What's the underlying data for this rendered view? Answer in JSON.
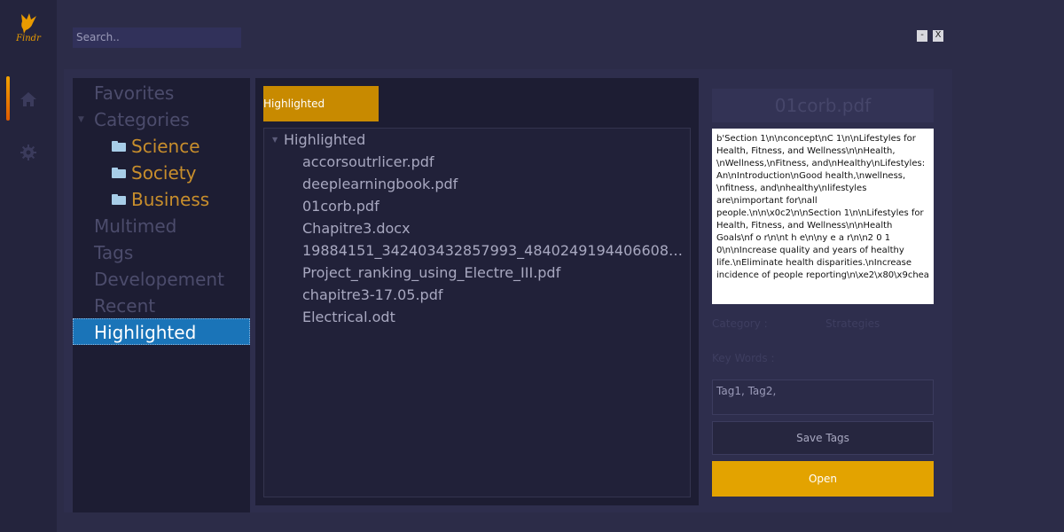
{
  "app": {
    "logo_text": "Findr"
  },
  "search": {
    "placeholder": "Search.."
  },
  "window": {
    "minimize": "-",
    "close": "X"
  },
  "sidebar": {
    "items": [
      {
        "label": "Favorites"
      },
      {
        "label": "Categories"
      },
      {
        "label": "Science"
      },
      {
        "label": "Society"
      },
      {
        "label": "Business"
      },
      {
        "label": "Multimed"
      },
      {
        "label": "Tags"
      },
      {
        "label": "Developement"
      },
      {
        "label": "Recent"
      },
      {
        "label": "Highlighted"
      }
    ],
    "active": "Highlighted"
  },
  "middle": {
    "tab_label": "Highlighted",
    "tree_root": "Highlighted",
    "files": [
      "accorsoutrlicer.pdf",
      "deeplearningbook.pdf",
      "01corb.pdf",
      "Chapitre3.docx",
      "19884151_342403432857993_4840249194406608117_n....",
      "Project_ranking_using_Electre_III.pdf",
      "chapitre3-17.05.pdf",
      "Electrical.odt"
    ]
  },
  "details": {
    "file_title": "01corb.pdf",
    "content": "b'Section 1\\n\\nconcept\\nC 1\\n\\nLifestyles for Health, Fitness, and Wellness\\n\\nHealth, \\nWellness,\\nFitness, and\\nHealthy\\nLifestyles: An\\nIntroduction\\nGood health,\\nwellness, \\nfitness, and\\nhealthy\\nlifestyles are\\nimportant for\\nall people.\\n\\n\\x0c2\\n\\nSection 1\\n\\nLifestyles for Health, Fitness, and Wellness\\n\\nHealth Goals\\nf o r\\n\\nt h e\\n\\ny e a r\\n\\n2 0 1 0\\n\\nIncrease quality and years of healthy life.\\nEliminate health disparities.\\nIncrease incidence of people reporting\\n\\xe2\\x80\\x9chea",
    "category_label": "Category :",
    "category_value": "Strategies",
    "keywords_label": "Key Words :",
    "tags_value": "Tag1, Tag2,",
    "save_label": "Save Tags",
    "open_label": "Open"
  },
  "colors": {
    "accent": "#e3a300",
    "tab": "#c88a00",
    "selection": "#1a74b8",
    "category_child": "#c88e2c"
  }
}
